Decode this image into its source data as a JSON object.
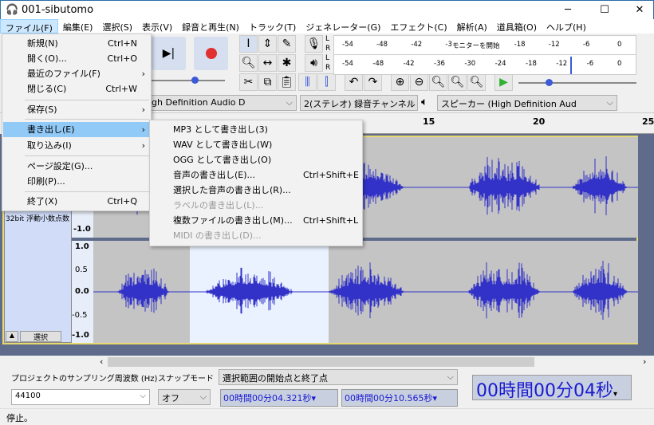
{
  "window": {
    "title": "001-sibutomo",
    "minimize": "─",
    "maximize": "☐",
    "close": "✕"
  },
  "menubar": [
    "ファイル(F)",
    "編集(E)",
    "選択(S)",
    "表示(V)",
    "録音と再生(N)",
    "トラック(T)",
    "ジェネレーター(G)",
    "エフェクト(C)",
    "解析(A)",
    "道具箱(O)",
    "ヘルプ(H)"
  ],
  "file_menu": [
    {
      "label": "新規(N)",
      "shortcut": "Ctrl+N"
    },
    {
      "label": "開く(O)...",
      "shortcut": "Ctrl+O"
    },
    {
      "label": "最近のファイル(F)",
      "submenu": "›"
    },
    {
      "label": "閉じる(C)",
      "shortcut": "Ctrl+W"
    },
    {
      "label": "保存(S)",
      "submenu": "›"
    },
    {
      "label": "書き出し(E)",
      "submenu": "›",
      "highlighted": true
    },
    {
      "label": "取り込み(I)",
      "submenu": "›"
    },
    {
      "label": "ページ設定(G)..."
    },
    {
      "label": "印刷(P)..."
    },
    {
      "label": "終了(X)",
      "shortcut": "Ctrl+Q"
    }
  ],
  "export_submenu": [
    {
      "label": "MP3 として書き出し(3)"
    },
    {
      "label": "WAV として書き出し(W)"
    },
    {
      "label": "OGG として書き出し(O)"
    },
    {
      "label": "音声の書き出し(E)...",
      "shortcut": "Ctrl+Shift+E"
    },
    {
      "label": "選択した音声の書き出し(R)..."
    },
    {
      "label": "ラベルの書き出し(L)...",
      "disabled": true
    },
    {
      "label": "複数ファイルの書き出し(M)...",
      "shortcut": "Ctrl+Shift+L"
    },
    {
      "label": "MIDI の書き出し(D)...",
      "disabled": true
    }
  ],
  "meters": {
    "record_ticks": [
      "-54",
      "-48",
      "-42",
      "-3",
      "-24",
      "-18",
      "-12",
      "-6",
      "0"
    ],
    "record_label": "モニターを開始",
    "play_ticks": [
      "-54",
      "-48",
      "-42",
      "-36",
      "-30",
      "-24",
      "-18",
      "-12",
      "-6",
      "0"
    ],
    "L": "L",
    "R": "R"
  },
  "devices": {
    "recording_device": "igh Definition Audio D",
    "channels": "2(ステレオ) 録音チャンネル",
    "playback_device": "スピーカー (High Definition Aud"
  },
  "ruler": [
    "15",
    "20",
    "25"
  ],
  "track": {
    "format": "32bit 浮動小数点数",
    "select_button": "選択",
    "scale": [
      "1.0",
      "0.5",
      "0.0",
      "-0.5",
      "-1.0"
    ]
  },
  "bottom": {
    "rate_label": "プロジェクトのサンプリング周波数 (Hz)",
    "rate_value": "44100",
    "snap_label": "スナップモード",
    "snap_value": "オフ",
    "selection_mode": "選択範囲の開始点と終了点",
    "sel_start": "00時間00分04.321秒",
    "sel_end": "00時間00分10.565秒",
    "time": "00時間00分04秒"
  },
  "status": "停止。",
  "colors": {
    "waveform": "#3232c8",
    "selection": "#eaf2ff",
    "menu_highlight": "#91c9f7",
    "record": "#e03030",
    "play": "#30b030"
  }
}
